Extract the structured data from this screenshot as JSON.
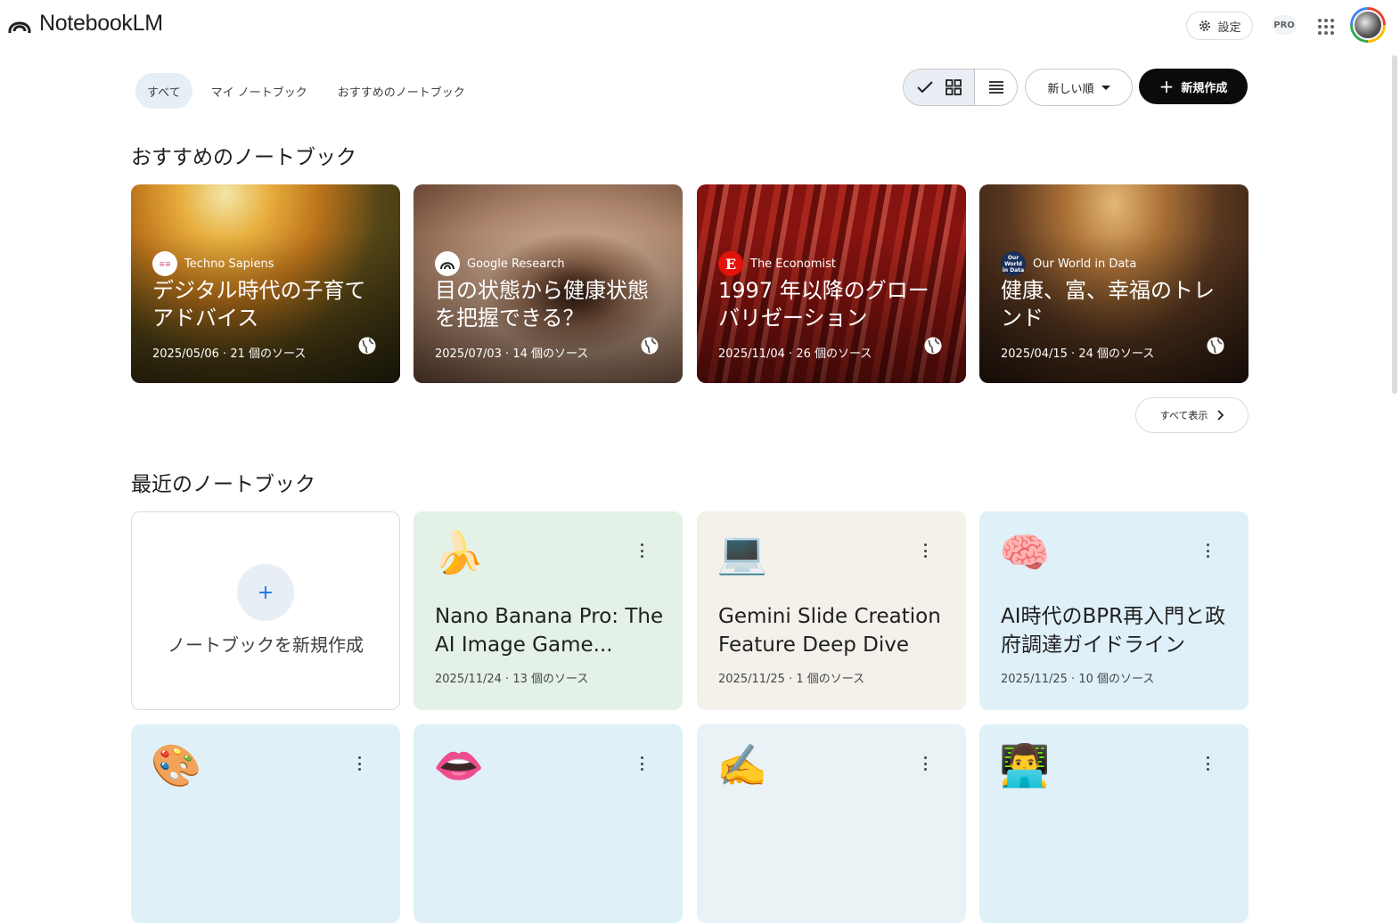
{
  "app": {
    "name": "NotebookLM"
  },
  "header": {
    "settings_label": "設定",
    "pro_label": "PRO"
  },
  "filters": {
    "tabs": [
      "すべて",
      "マイ ノートブック",
      "おすすめのノートブック"
    ],
    "active": "すべて"
  },
  "toolbar": {
    "sort_label": "新しい順",
    "new_label": "新規作成"
  },
  "featured": {
    "title": "おすすめのノートブック",
    "show_all": "すべて表示",
    "cards": [
      {
        "source": "Techno Sapiens",
        "title": "デジタル時代の子育てアドバイス",
        "meta": "2025/05/06 · 21 個のソース"
      },
      {
        "source": "Google Research",
        "title": "目の状態から健康状態を把握できる？",
        "meta": "2025/07/03 · 14 個のソース"
      },
      {
        "source": "The Economist",
        "title": "1997 年以降のグローバリゼーション",
        "meta": "2025/11/04 · 26 個のソース"
      },
      {
        "source": "Our World in Data",
        "title": "健康、富、幸福のトレンド",
        "meta": "2025/04/15 · 24 個のソース"
      }
    ]
  },
  "recent": {
    "title": "最近のノートブック",
    "create_label": "ノートブックを新規作成",
    "notebooks": [
      {
        "emoji": "🍌",
        "title": "Nano Banana Pro: The AI Image Game...",
        "meta": "2025/11/24 · 13 個のソース",
        "bg": "#e3f1e6"
      },
      {
        "emoji": "💻",
        "title": "Gemini Slide Creation Feature Deep Dive",
        "meta": "2025/11/25 · 1 個のソース",
        "bg": "#f3f1ea"
      },
      {
        "emoji": "🧠",
        "title": "AI時代のBPR再入門と政府調達ガイドライン",
        "meta": "2025/11/25 · 10 個のソース",
        "bg": "#dff0f8"
      },
      {
        "emoji": "🎨",
        "title": "",
        "meta": "",
        "bg": "#dff0f8"
      },
      {
        "emoji": "👄",
        "title": "",
        "meta": "",
        "bg": "#dff0f8"
      },
      {
        "emoji": "✍️",
        "title": "",
        "meta": "",
        "bg": "#eaf2f6"
      },
      {
        "emoji": "👨‍💻",
        "title": "",
        "meta": "",
        "bg": "#dff0f8"
      }
    ]
  },
  "icons": [
    "notebooklm-logo-icon",
    "gear-icon",
    "apps-grid-icon",
    "check-icon",
    "grid-view-icon",
    "list-view-icon",
    "caret-down-icon",
    "plus-icon",
    "globe-icon",
    "chevron-right-icon",
    "more-vert-icon"
  ]
}
